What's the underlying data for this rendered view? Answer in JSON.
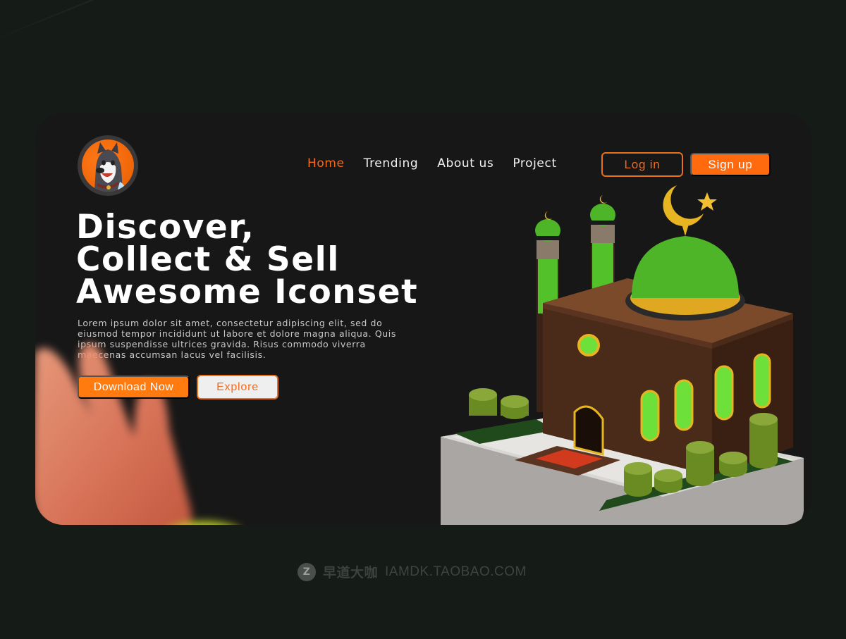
{
  "nav": {
    "items": [
      {
        "label": "Home",
        "active": true
      },
      {
        "label": "Trending",
        "active": false
      },
      {
        "label": "About us",
        "active": false
      },
      {
        "label": "Project",
        "active": false
      }
    ],
    "login_label": "Log in",
    "signup_label": "Sign up"
  },
  "hero": {
    "headline_lines": [
      "Discover,",
      "Collect & Sell",
      "Awesome Iconset"
    ],
    "body": "Lorem ipsum dolor sit amet, consectetur adipiscing elit, sed do eiusmod tempor incididunt ut labore et dolore magna aliqua. Quis ipsum suspendisse ultrices gravida. Risus commodo viverra maecenas accumsan lacus vel facilisis.",
    "primary_cta": "Download Now",
    "secondary_cta": "Explore"
  },
  "logo": {
    "icon": "husky-dog-avatar-icon"
  },
  "illustration": {
    "icon": "3d-mosque-icon"
  },
  "decor": {
    "icon": "blurred-hand-icon"
  },
  "watermark": {
    "logo_letter": "Z",
    "brand_cn": "早道大咖",
    "url": "IAMDK.TAOBAO.COM"
  },
  "colors": {
    "accent": "#ff6a0f",
    "page_bg": "#151c17",
    "card_bg": "#171717",
    "text": "#ffffff",
    "muted_text": "#c9c9c9"
  }
}
